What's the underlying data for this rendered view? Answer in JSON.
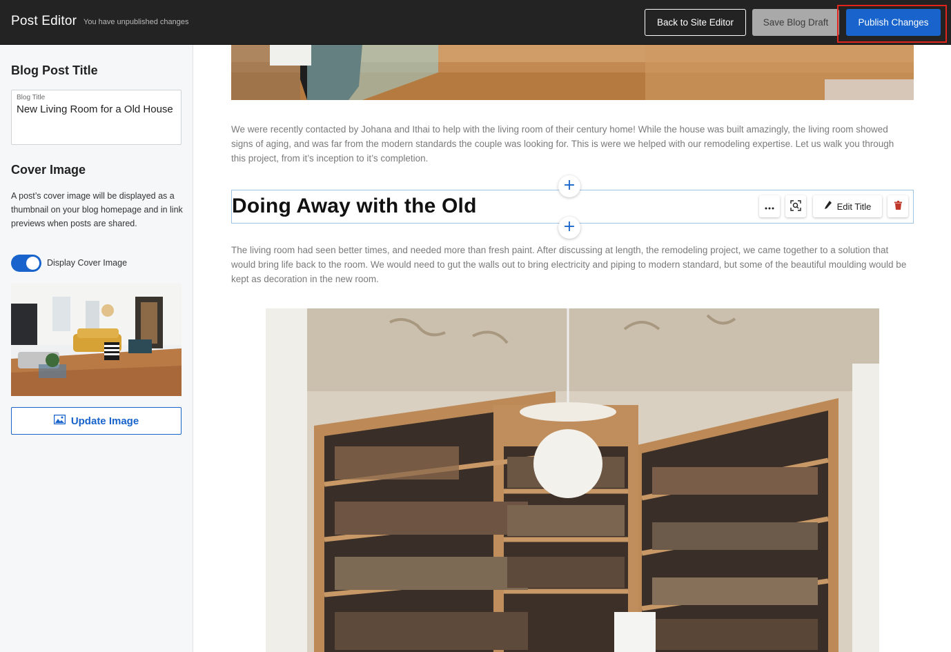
{
  "header": {
    "title": "Post Editor",
    "status": "You have unpublished changes",
    "back_label": "Back to Site Editor",
    "draft_label": "Save Blog Draft",
    "publish_label": "Publish Changes"
  },
  "sidebar": {
    "title_heading": "Blog Post Title",
    "title_field_label": "Blog Title",
    "title_field_value": "New Living Room for a Old House",
    "cover_heading": "Cover Image",
    "cover_description": "A post’s cover image will be displayed as a thumbnail on your blog homepage and in link previews when posts are shared.",
    "toggle_label": "Display Cover Image",
    "toggle_on": true,
    "update_label": "Update Image"
  },
  "main": {
    "paragraph_1": "We were recently contacted by Johana and Ithai to help with the living room of their century home! While the house was built amazingly, the living room showed signs of aging, and was far from the modern standards the couple was looking for. This is were we helped with our remodeling expertise. Let us walk you through this project, from it’s inception to it’s completion.",
    "heading": "Doing Away with the Old",
    "edit_title_label": "Edit Title",
    "paragraph_2": "The living room had seen better times, and needed more than fresh paint. After discussing at length, the remodeling project, we came together to a solution that would bring life back to the room. We would need to gut the walls out to bring electricity and piping to modern standard, but some of the beautiful moulding would be kept as decoration in the new room."
  },
  "colors": {
    "primary": "#1863cc",
    "header_bg": "#232323",
    "highlight": "#e1251b",
    "delete": "#c0392b"
  }
}
